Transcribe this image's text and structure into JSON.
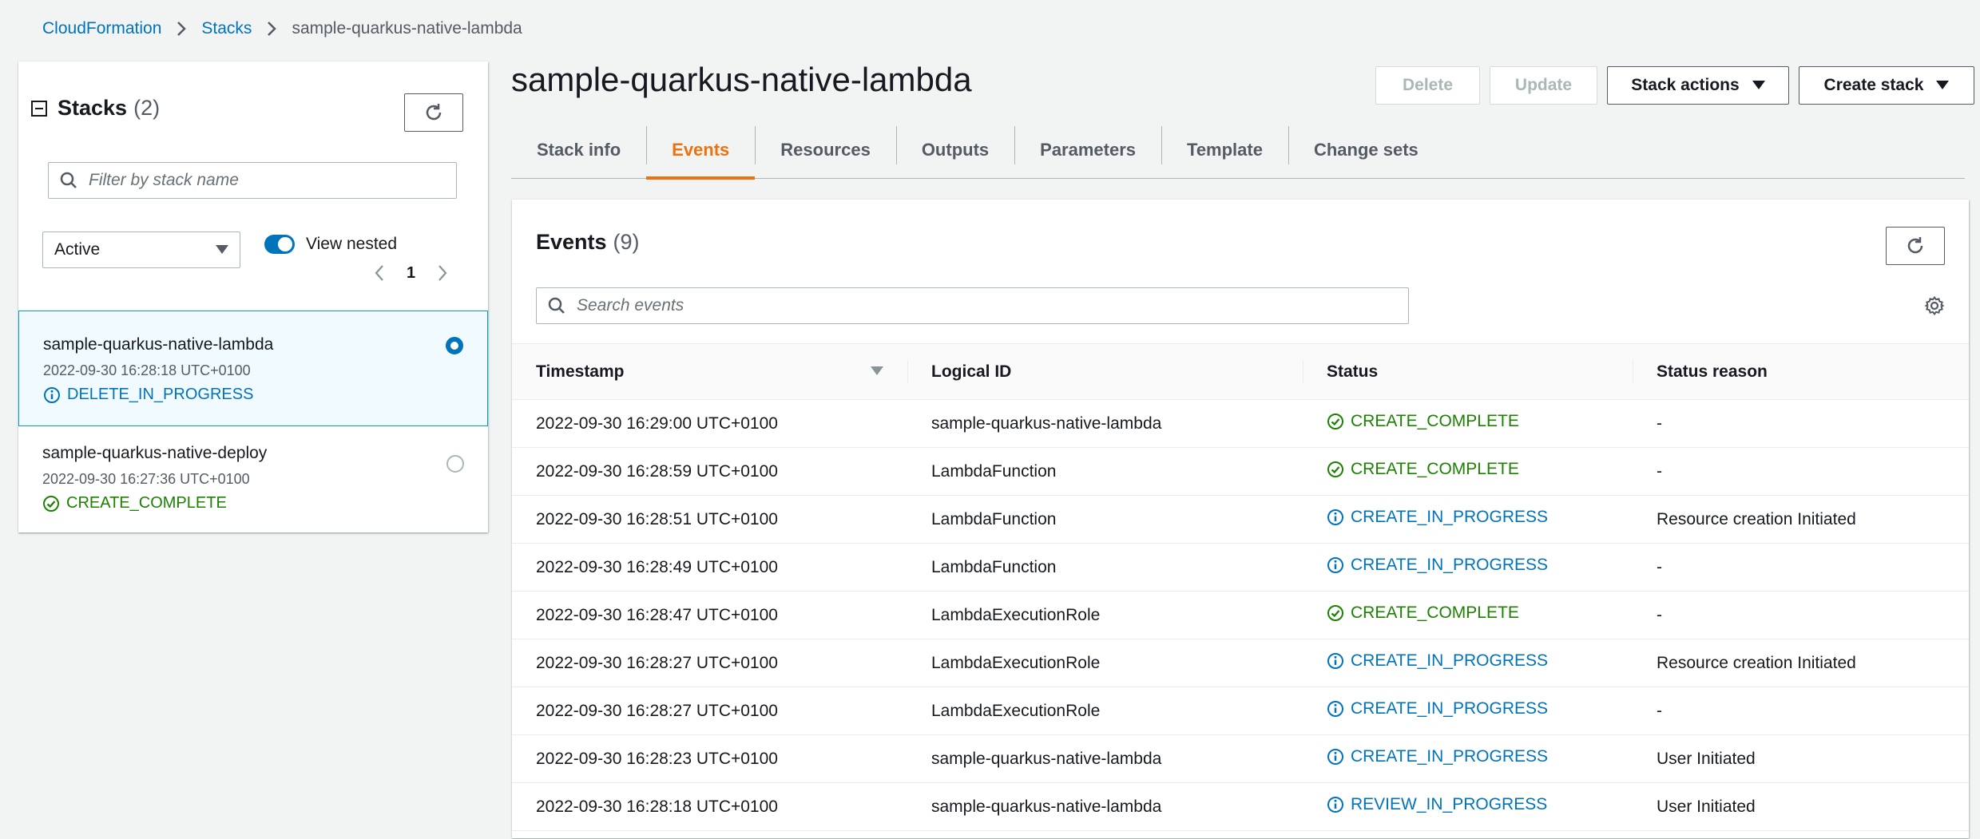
{
  "breadcrumb": {
    "items": [
      "CloudFormation",
      "Stacks"
    ],
    "current": "sample-quarkus-native-lambda"
  },
  "left_panel": {
    "title": "Stacks",
    "count": "(2)",
    "search_placeholder": "Filter by stack name",
    "filter_value": "Active",
    "view_nested_label": "View nested",
    "page": "1",
    "stacks": [
      {
        "name": "sample-quarkus-native-lambda",
        "date": "2022-09-30 16:28:18 UTC+0100",
        "status": "DELETE_IN_PROGRESS",
        "status_type": "info",
        "selected": true
      },
      {
        "name": "sample-quarkus-native-deploy",
        "date": "2022-09-30 16:27:36 UTC+0100",
        "status": "CREATE_COMPLETE",
        "status_type": "success",
        "selected": false
      }
    ]
  },
  "header": {
    "title": "sample-quarkus-native-lambda",
    "delete_label": "Delete",
    "update_label": "Update",
    "stack_actions_label": "Stack actions",
    "create_stack_label": "Create stack"
  },
  "tabs": [
    "Stack info",
    "Events",
    "Resources",
    "Outputs",
    "Parameters",
    "Template",
    "Change sets"
  ],
  "active_tab": "Events",
  "events": {
    "title": "Events",
    "count": "(9)",
    "search_placeholder": "Search events",
    "columns": [
      "Timestamp",
      "Logical ID",
      "Status",
      "Status reason"
    ],
    "rows": [
      {
        "timestamp": "2022-09-30 16:29:00 UTC+0100",
        "logical_id": "sample-quarkus-native-lambda",
        "status": "CREATE_COMPLETE",
        "status_type": "success",
        "reason": "-"
      },
      {
        "timestamp": "2022-09-30 16:28:59 UTC+0100",
        "logical_id": "LambdaFunction",
        "status": "CREATE_COMPLETE",
        "status_type": "success",
        "reason": "-"
      },
      {
        "timestamp": "2022-09-30 16:28:51 UTC+0100",
        "logical_id": "LambdaFunction",
        "status": "CREATE_IN_PROGRESS",
        "status_type": "info",
        "reason": "Resource creation Initiated"
      },
      {
        "timestamp": "2022-09-30 16:28:49 UTC+0100",
        "logical_id": "LambdaFunction",
        "status": "CREATE_IN_PROGRESS",
        "status_type": "info",
        "reason": "-"
      },
      {
        "timestamp": "2022-09-30 16:28:47 UTC+0100",
        "logical_id": "LambdaExecutionRole",
        "status": "CREATE_COMPLETE",
        "status_type": "success",
        "reason": "-"
      },
      {
        "timestamp": "2022-09-30 16:28:27 UTC+0100",
        "logical_id": "LambdaExecutionRole",
        "status": "CREATE_IN_PROGRESS",
        "status_type": "info",
        "reason": "Resource creation Initiated"
      },
      {
        "timestamp": "2022-09-30 16:28:27 UTC+0100",
        "logical_id": "LambdaExecutionRole",
        "status": "CREATE_IN_PROGRESS",
        "status_type": "info",
        "reason": "-"
      },
      {
        "timestamp": "2022-09-30 16:28:23 UTC+0100",
        "logical_id": "sample-quarkus-native-lambda",
        "status": "CREATE_IN_PROGRESS",
        "status_type": "info",
        "reason": "User Initiated"
      },
      {
        "timestamp": "2022-09-30 16:28:18 UTC+0100",
        "logical_id": "sample-quarkus-native-lambda",
        "status": "REVIEW_IN_PROGRESS",
        "status_type": "info",
        "reason": "User Initiated"
      }
    ]
  },
  "colors": {
    "link": "#0073bb",
    "success": "#1d8102",
    "active_tab": "#ec7211",
    "background": "#f2f3f3"
  }
}
